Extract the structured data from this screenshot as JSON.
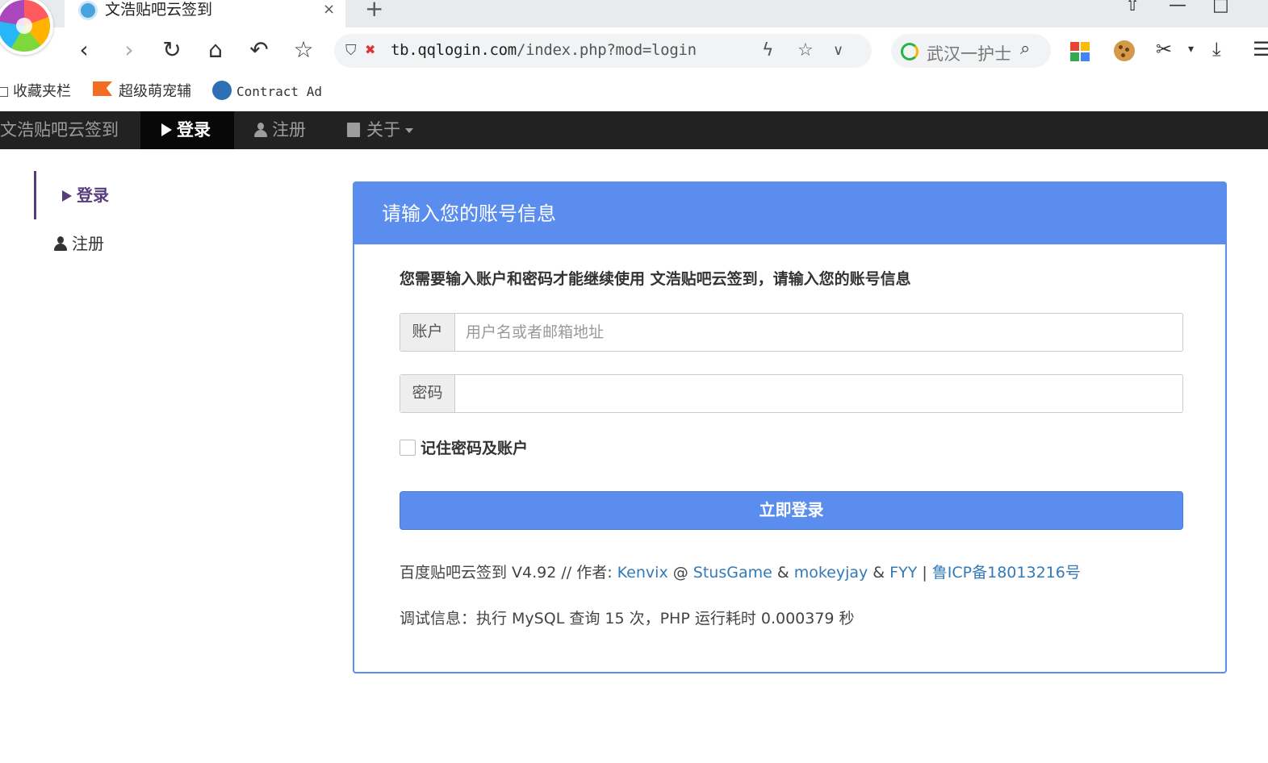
{
  "browser": {
    "tab_title": "文浩贴吧云签到",
    "tab_close": "×",
    "new_tab": "+",
    "url_host": "tb.qqlogin.com",
    "url_path": "/index.php?mod=login",
    "search_text": "武汉一护士",
    "bookmarks": [
      "收藏夹栏",
      "超级萌宠辅",
      "Contract Ad"
    ]
  },
  "navbar": {
    "brand": "文浩贴吧云签到",
    "login": "登录",
    "register": "注册",
    "about": "关于"
  },
  "sidenav": {
    "login": "登录",
    "register": "注册"
  },
  "panel": {
    "heading": "请输入您的账号信息",
    "intro": "您需要输入账户和密码才能继续使用 文浩贴吧云签到，请输入您的账号信息",
    "account_label": "账户",
    "account_placeholder": "用户名或者邮箱地址",
    "password_label": "密码",
    "remember": "记住密码及账户",
    "submit": "立即登录"
  },
  "footer": {
    "prefix": "百度贴吧云签到 V4.92 // 作者: ",
    "author1": "Kenvix",
    "at": " @ ",
    "author2": "StusGame",
    "amp1": " & ",
    "author3": "mokeyjay",
    "amp2": " & ",
    "author4": "FYY",
    "sep": " | ",
    "icp": "鲁ICP备18013216号",
    "debug": "调试信息：执行 MySQL 查询 15 次，PHP 运行耗时 0.000379 秒"
  },
  "colors": {
    "primary": "#5b8def",
    "navbar": "#222222",
    "side_active": "#563d7c",
    "link": "#337ab7"
  }
}
